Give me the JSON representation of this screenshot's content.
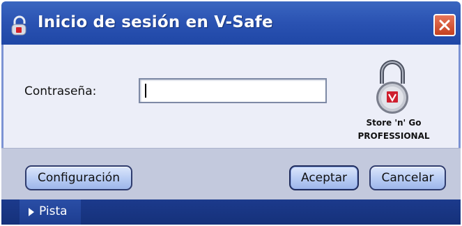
{
  "window": {
    "title": "Inicio de sesión en V-Safe",
    "icons": {
      "app": "padlock-app-icon",
      "close": "close-icon"
    }
  },
  "form": {
    "password_label": "Contraseña:",
    "password_value": ""
  },
  "branding": {
    "line1": "Store 'n' Go",
    "line2": "PROFESSIONAL",
    "lock_icon": "padlock-v-icon"
  },
  "buttons": {
    "config": "Configuración",
    "accept": "Aceptar",
    "cancel": "Cancelar"
  },
  "hint": {
    "label": "Pista",
    "icon": "triangle-right-icon"
  },
  "colors": {
    "titlebar": "#2a52b2",
    "close_button": "#c4401f",
    "button_face": "#b7cbf3",
    "hint_bar": "#1c3a8c"
  }
}
